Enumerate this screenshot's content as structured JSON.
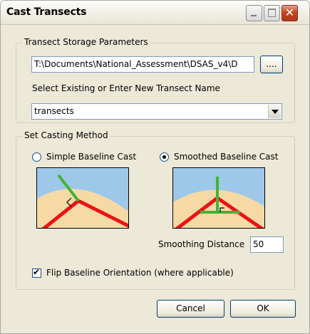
{
  "window": {
    "title": "Cast Transects"
  },
  "storage_group": {
    "label": "Transect Storage Parameters",
    "path_value": "T:\\Documents\\National_Assessment\\DSAS_v4\\D",
    "browse_label": "....",
    "select_label": "Select Existing or Enter New Transect Name",
    "transect_name": "transects"
  },
  "casting_group": {
    "label": "Set Casting Method",
    "simple_label": "Simple Baseline Cast",
    "smoothed_label": "Smoothed Baseline Cast",
    "selected": "smoothed",
    "smoothing_label": "Smoothing Distance",
    "smoothing_value": "50",
    "flip_label": "Flip Baseline Orientation (where applicable)",
    "flip_checked": true
  },
  "buttons": {
    "cancel": "Cancel",
    "ok": "OK"
  },
  "colors": {
    "sky": "#9ec8e8",
    "sand": "#f7d9a6",
    "baseline": "#ee1111",
    "transect": "#44b23a"
  }
}
